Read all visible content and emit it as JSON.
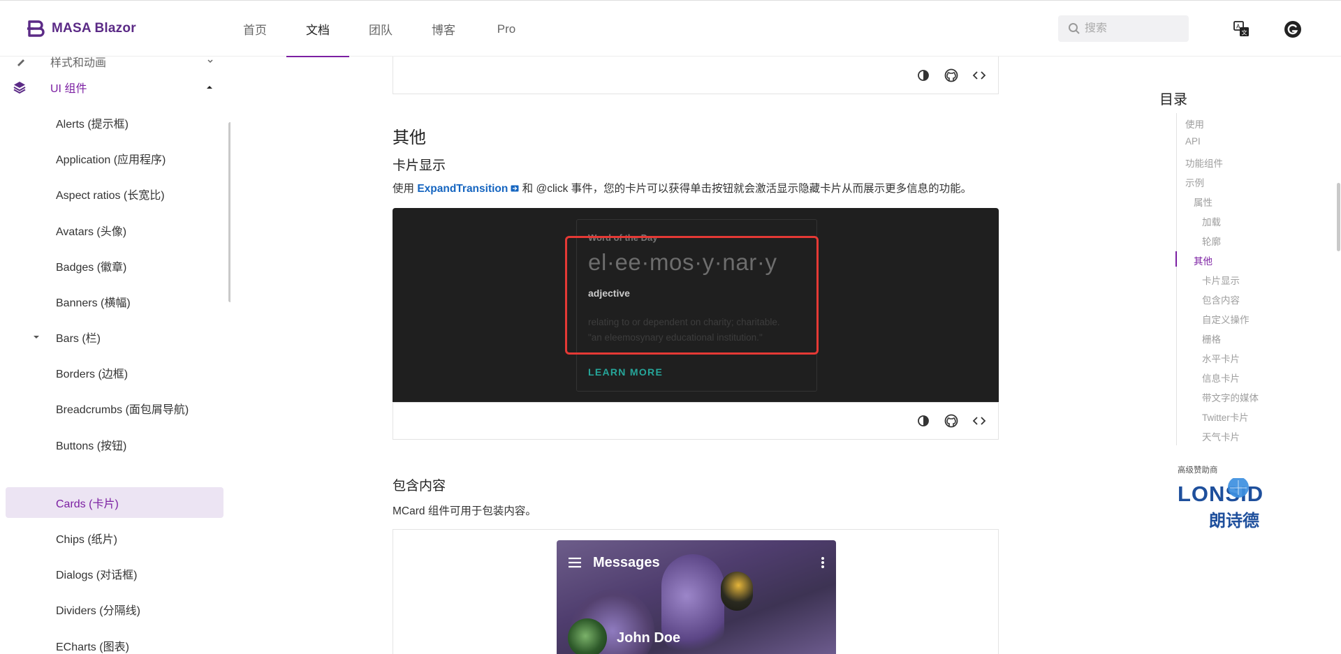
{
  "header": {
    "brand": "MASA Blazor",
    "nav": [
      "首页",
      "文档",
      "团队",
      "博客",
      "Pro"
    ],
    "active_nav": "文档",
    "search_placeholder": "搜索"
  },
  "sidebar": {
    "partial_item": "样式和动画",
    "group_label": "UI 组件",
    "items": [
      "Alerts (提示框)",
      "Application (应用程序)",
      "Aspect ratios (长宽比)",
      "Avatars (头像)",
      "Badges (徽章)",
      "Banners (横幅)",
      "Bars (栏)",
      "Borders (边框)",
      "Breadcrumbs (面包屑导航)",
      "Buttons (按钮)",
      "Cards (卡片)",
      "Chips (纸片)",
      "Dialogs (对话框)",
      "Dividers (分隔线)",
      "ECharts (图表)"
    ],
    "active_item": "Cards (卡片)"
  },
  "main": {
    "section_other": "其他",
    "sub_card_display": "卡片显示",
    "desc_prefix": "使用 ",
    "desc_link": "ExpandTransition",
    "desc_suffix": " 和 @click 事件，您的卡片可以获得单击按钮就会激活显示隐藏卡片从而展示更多信息的功能。",
    "word_card": {
      "overline": "Word of the Day",
      "word": "el·ee·mos·y·nar·y",
      "part_of_speech": "adjective",
      "definition_line1": "relating to or dependent on charity; charitable.",
      "definition_line2": "\"an eleemosynary educational institution.\"",
      "button": "LEARN MORE"
    },
    "section_content": "包含内容",
    "desc_content": "MCard 组件可用于包装内容。",
    "messages_card": {
      "title": "Messages",
      "user": "John Doe"
    }
  },
  "toc": {
    "title": "目录",
    "items": [
      {
        "label": "使用",
        "level": 0
      },
      {
        "label": "API",
        "level": 0
      },
      {
        "label": "功能组件",
        "level": 0
      },
      {
        "label": "示例",
        "level": 0
      },
      {
        "label": "属性",
        "level": 1
      },
      {
        "label": "加载",
        "level": 2
      },
      {
        "label": "轮廓",
        "level": 2
      },
      {
        "label": "其他",
        "level": 1
      },
      {
        "label": "卡片显示",
        "level": 2
      },
      {
        "label": "包含内容",
        "level": 2
      },
      {
        "label": "自定义操作",
        "level": 2
      },
      {
        "label": "栅格",
        "level": 2
      },
      {
        "label": "水平卡片",
        "level": 2
      },
      {
        "label": "信息卡片",
        "level": 2
      },
      {
        "label": "带文字的媒体",
        "level": 2
      },
      {
        "label": "Twitter卡片",
        "level": 2
      },
      {
        "label": "天气卡片",
        "level": 2
      }
    ],
    "active": "其他",
    "sponsor_label": "高级赞助商",
    "sponsor_name": "LONSID",
    "sponsor_cn": "朗诗德"
  },
  "colors": {
    "accent": "#7b1fa2",
    "link": "#1565c0",
    "highlight": "#e53935",
    "learn_more": "#26a69a"
  }
}
